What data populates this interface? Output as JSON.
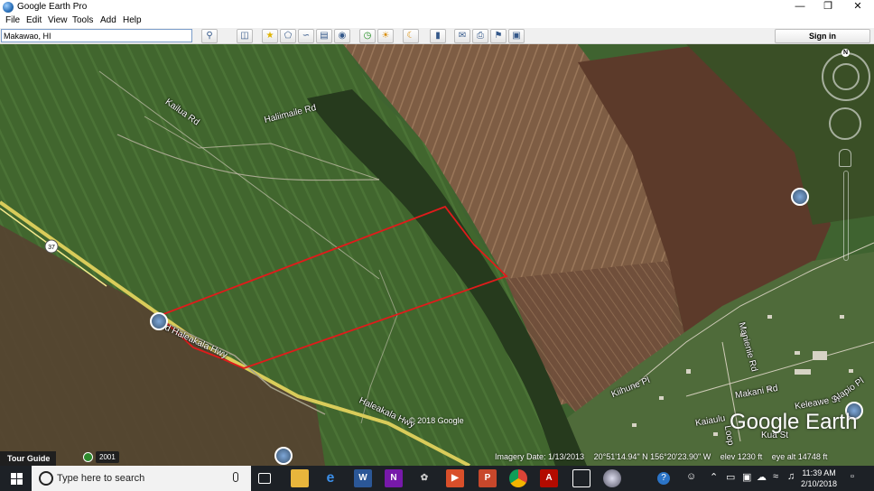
{
  "window": {
    "title": "Google Earth Pro",
    "minimize": "—",
    "restore": "❐",
    "close": "✕"
  },
  "menu": [
    "File",
    "Edit",
    "View",
    "Tools",
    "Add",
    "Help"
  ],
  "toolbar": {
    "search_value": "Makawao, HI",
    "signin_label": "Sign in"
  },
  "map": {
    "roads": {
      "kailua": "Kailua Rd",
      "haliimaile": "Haliimaile Rd",
      "old_haleakala": "Old Haleakala Hwy",
      "haleakala": "Haleakala Hwy",
      "kiihune": "Kiihune Pl",
      "makani": "Makani Rd",
      "keleawe": "Keleawe St",
      "alapio": "Alapio Pl",
      "kaiaulu": "Kaiaulu",
      "manienie": "Manienie Rd",
      "loop": "Loop",
      "kua": "Kua St",
      "route": "37"
    },
    "copyright": "© 2018 Google",
    "brand": "Google Earth",
    "north": "N",
    "status": {
      "imagery_date": "Imagery Date: 1/13/2013",
      "coords": "20°51'14.94\" N   156°20'23.90\" W",
      "elev": "elev  1230 ft",
      "eye_alt": "eye alt  14748 ft"
    },
    "tour_guide": "Tour Guide",
    "year": "2001",
    "colors": {
      "polygon": "#e01b1b",
      "highway": "#d9cc5a"
    }
  },
  "taskbar": {
    "search_placeholder": "Type here to search",
    "time": "11:39 AM",
    "date": "2/10/2018",
    "apps": [
      "task-view-icon",
      "file-explorer-icon",
      "edge-icon",
      "word-icon",
      "onenote-icon",
      "game-icon",
      "media-player-icon",
      "powerpoint-icon",
      "chrome-icon",
      "acrobat-icon",
      "photos-icon",
      "google-earth-icon"
    ]
  }
}
